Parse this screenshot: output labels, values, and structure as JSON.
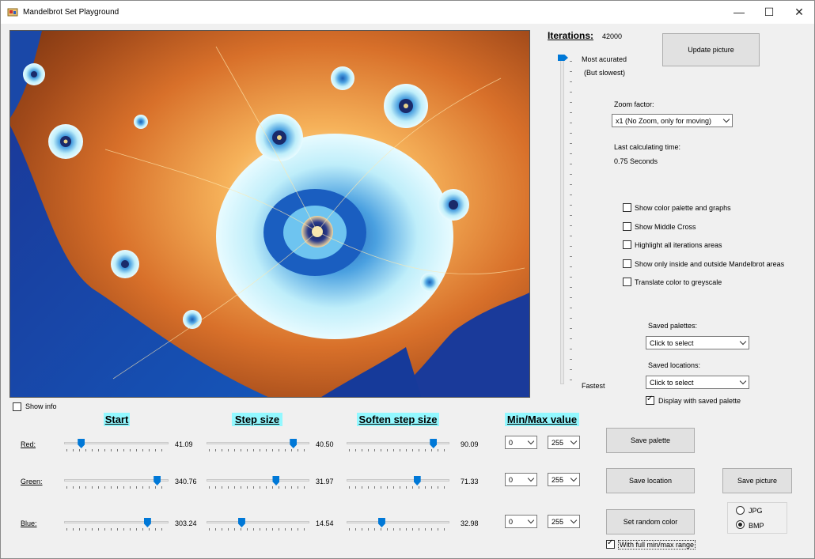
{
  "window": {
    "title": "Mandelbrot Set Playground"
  },
  "iterations": {
    "label": "Iterations:",
    "value": "42000",
    "top_label": "Most acurated",
    "top_sublabel": "(But slowest)",
    "bottom_label": "Fastest"
  },
  "buttons": {
    "update_picture": "Update picture",
    "save_palette": "Save  palette",
    "save_location": "Save location",
    "save_picture": "Save picture",
    "set_random_color": "Set random color"
  },
  "zoom": {
    "label": "Zoom factor:",
    "value": "x1 (No Zoom, only for moving)"
  },
  "calc_time": {
    "label": "Last calculating time:",
    "value": "0.75 Seconds"
  },
  "options": [
    {
      "label": "Show color palette and graphs",
      "checked": false
    },
    {
      "label": "Show Middle Cross",
      "checked": false
    },
    {
      "label": "Highlight all iterations areas",
      "checked": false
    },
    {
      "label": "Show only inside and outside Mandelbrot areas",
      "checked": false
    },
    {
      "label": "Translate color to greyscale",
      "checked": false
    }
  ],
  "saved_palettes": {
    "label": "Saved palettes:",
    "value": "Click to select"
  },
  "saved_locations": {
    "label": "Saved locations:",
    "value": "Click to select"
  },
  "display_with_saved_palette": {
    "label": "Display with saved palette",
    "checked": true
  },
  "show_info": {
    "label": "Show info",
    "checked": false
  },
  "headers": {
    "start": "Start",
    "step": "Step size",
    "soften": "Soften step size",
    "minmax": "Min/Max value"
  },
  "channels": [
    {
      "name": "Red:",
      "start": "41.09",
      "start_pos": 0.14,
      "step": "40.50",
      "step_pos": 0.87,
      "soften": "90.09",
      "soften_pos": 0.87,
      "min": "0",
      "max": "255"
    },
    {
      "name": "Green:",
      "start": "340.76",
      "start_pos": 0.92,
      "step": "31.97",
      "step_pos": 0.69,
      "soften": "71.33",
      "soften_pos": 0.7,
      "min": "0",
      "max": "255"
    },
    {
      "name": "Blue:",
      "start": "303.24",
      "start_pos": 0.82,
      "step": "14.54",
      "step_pos": 0.33,
      "soften": "32.98",
      "soften_pos": 0.33,
      "min": "0",
      "max": "255"
    }
  ],
  "format": {
    "jpg": "JPG",
    "bmp": "BMP",
    "selected": "BMP"
  },
  "full_range": {
    "label": "With full min/max range",
    "checked": true
  },
  "colors": {
    "accent": "#0078d7",
    "header_bg": "#93f8ff"
  }
}
